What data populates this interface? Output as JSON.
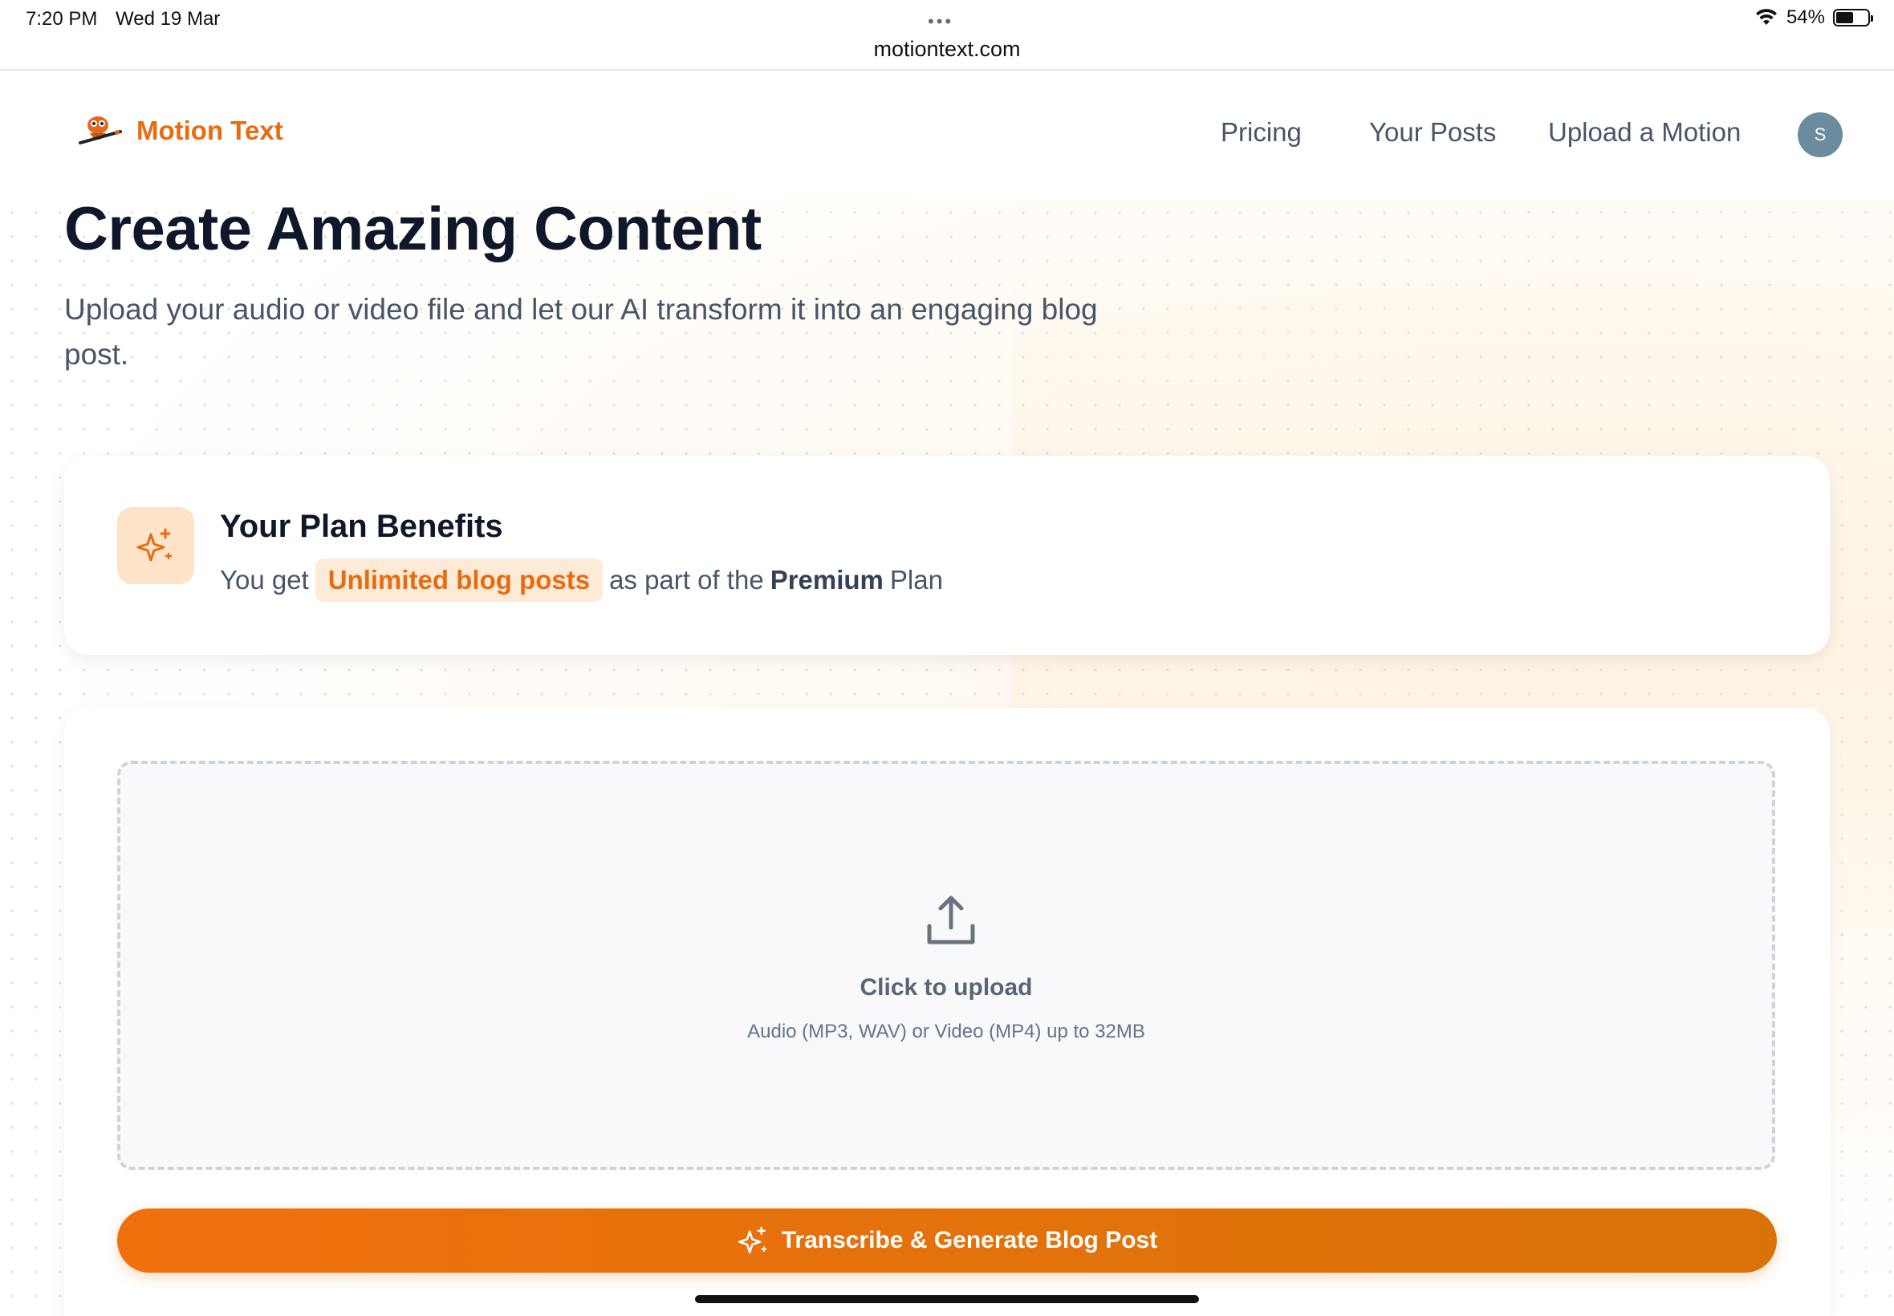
{
  "status_bar": {
    "time": "7:20 PM",
    "date": "Wed 19 Mar",
    "dots": "•••",
    "url": "motiontext.com",
    "battery_percent": "54%",
    "battery_level": 0.54
  },
  "nav": {
    "brand": "Motion Text",
    "links": [
      "Pricing",
      "Your Posts",
      "Upload a Motion"
    ],
    "avatar_initial": "S"
  },
  "hero": {
    "title": "Create Amazing Content",
    "subtitle": "Upload your audio or video file and let our AI transform it into an engaging blog post."
  },
  "plan": {
    "title": "Your Plan Benefits",
    "prefix": "You get",
    "badge": "Unlimited blog posts",
    "middle": "as part of the",
    "plan_name": "Premium",
    "suffix": "Plan"
  },
  "upload": {
    "title": "Click to upload",
    "hint": "Audio (MP3, WAV) or Video (MP4) up to 32MB"
  },
  "cta": {
    "label": "Transcribe & Generate Blog Post"
  },
  "colors": {
    "accent": "#ea6a0f",
    "cta_start": "#f0700e",
    "cta_end": "#d97309",
    "avatar": "#6b8b9e"
  },
  "icons": [
    "wifi-icon",
    "battery-icon",
    "sparkles-icon",
    "upload-icon"
  ]
}
